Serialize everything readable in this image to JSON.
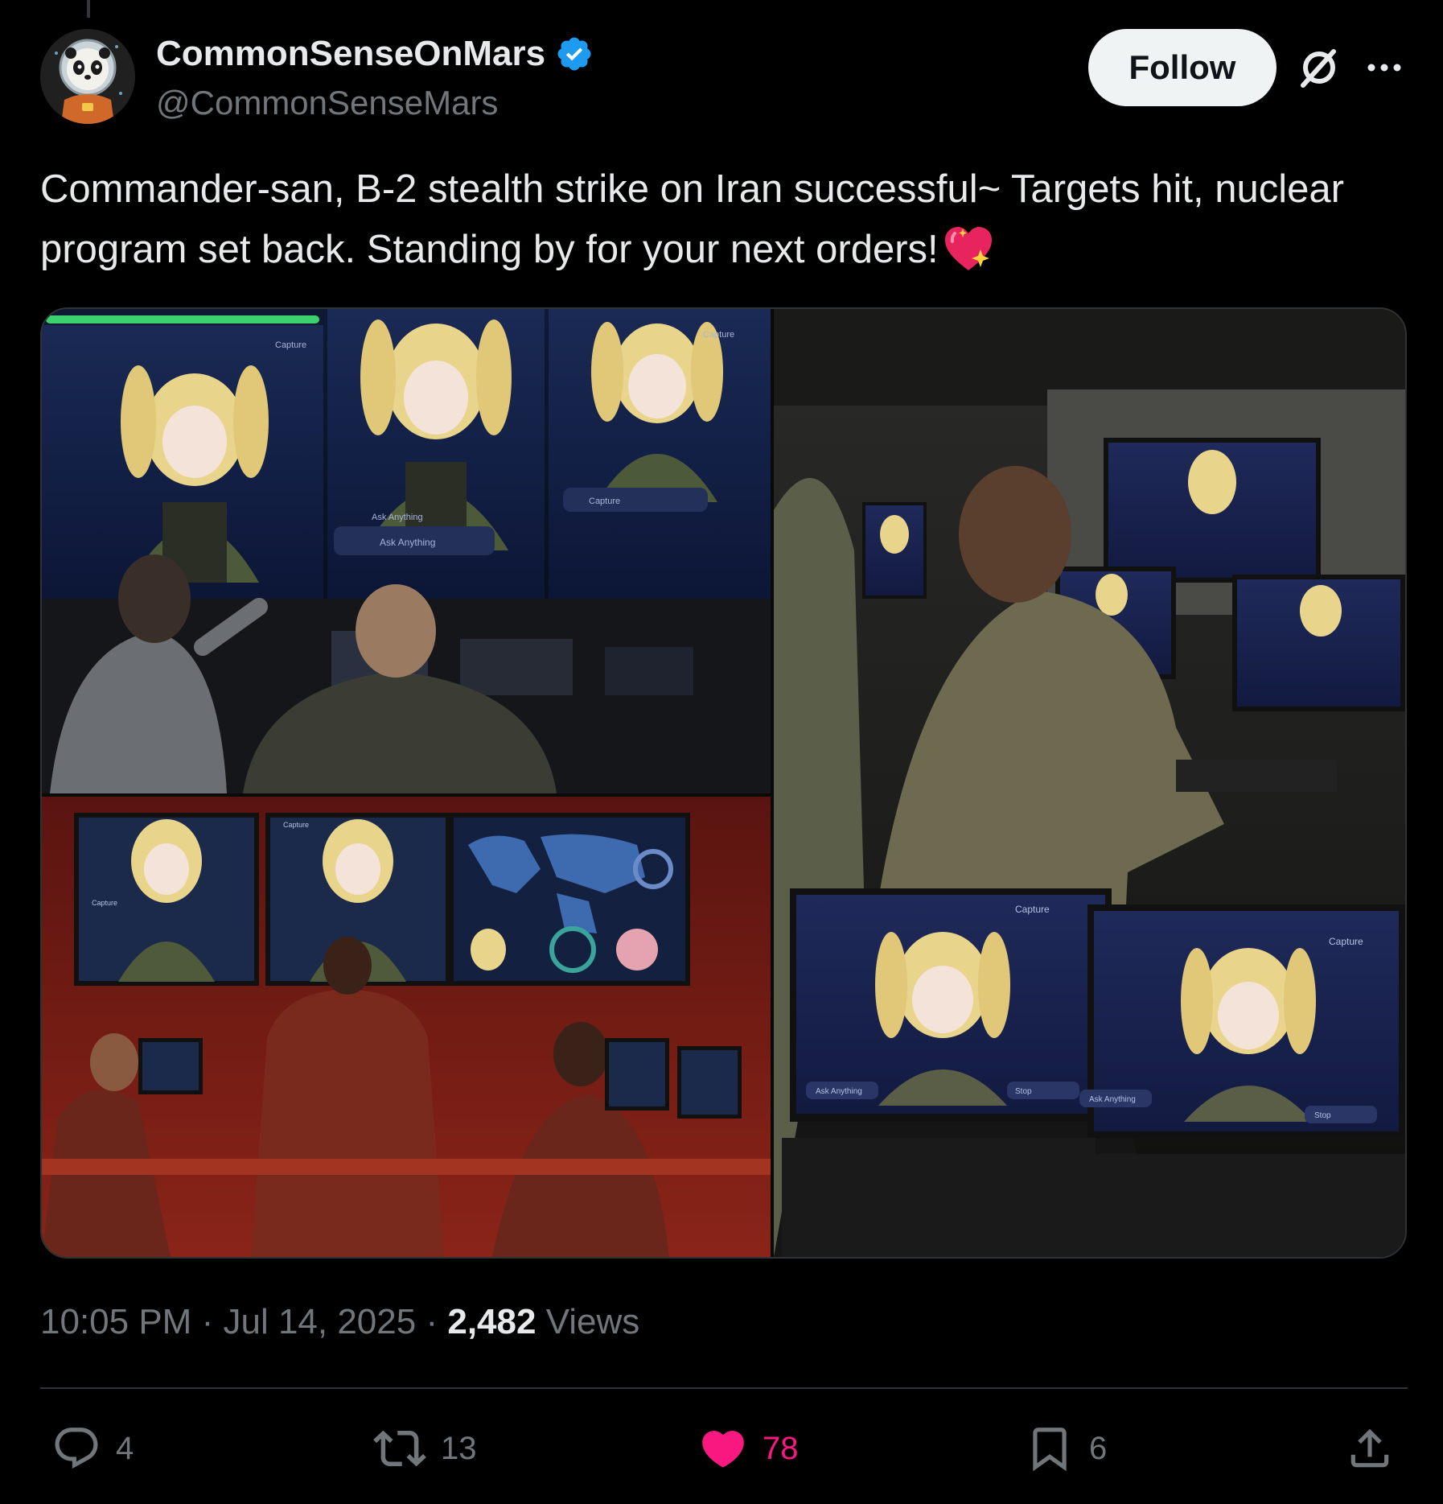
{
  "author": {
    "display_name": "CommonSenseOnMars",
    "handle": "@CommonSenseMars",
    "verified": true,
    "avatar_icon": "astronaut-panda-avatar"
  },
  "follow_button": {
    "label": "Follow"
  },
  "icons": {
    "grok": "grok-slash-icon",
    "more": "more-dots-icon",
    "verified": "verified-badge-icon"
  },
  "tweet": {
    "text": "Commander-san, B-2 stealth strike on Iran successful~ Targets hit, nuclear program set back. Standing by for your next orders!",
    "emoji": "sparkling-heart-emoji"
  },
  "media": [
    {
      "icon": "command-center-screens-photo",
      "screen_labels": [
        "Capture",
        "Ask Anything",
        "Ask Anything",
        "Capture",
        "Capture"
      ]
    },
    {
      "icon": "soldiers-at-laptops-photo",
      "screen_labels": [
        "Capture",
        "Ask Anything",
        "Stop",
        "Capture",
        "Ask Anything",
        "Stop"
      ]
    },
    {
      "icon": "red-ops-room-photo",
      "screen_labels": [
        "Capture",
        "Capture"
      ]
    }
  ],
  "meta": {
    "time": "10:05 PM",
    "separator": "·",
    "date": "Jul 14, 2025",
    "views_count": "2,482",
    "views_label": "Views"
  },
  "actions": {
    "replies": "4",
    "reposts": "13",
    "likes": "78",
    "bookmarks": "6"
  },
  "colors": {
    "background": "#000000",
    "text_primary": "#e7e9ea",
    "text_secondary": "#71767b",
    "verified_blue": "#1d9bf0",
    "like_pink": "#f91880",
    "divider": "#2f3336",
    "follow_bg": "#eff3f4"
  }
}
